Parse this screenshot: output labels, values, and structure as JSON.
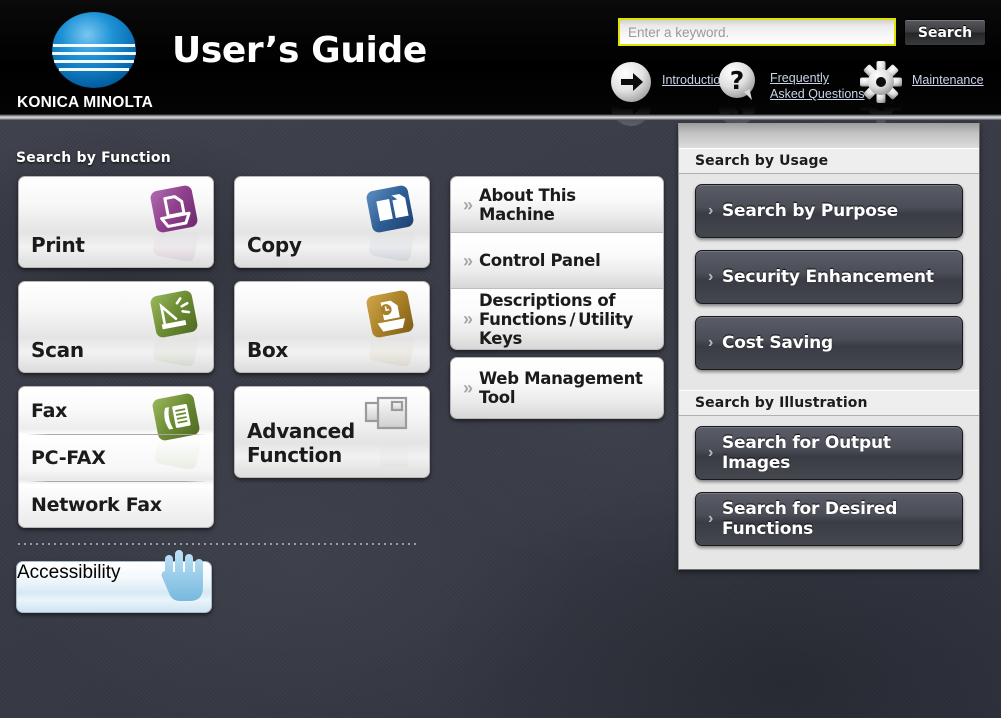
{
  "header": {
    "brand_name": "KONICA MINOLTA",
    "logo_icon": "konica-minolta-globe-logo",
    "title": "User’s Guide",
    "search": {
      "placeholder": "Enter a keyword.",
      "value": "",
      "button_label": "Search",
      "border_color": "#e3e300"
    },
    "nav_links": [
      {
        "label": "Introduction",
        "icon": "arrow-right-circle-icon"
      },
      {
        "label": "Frequently Asked Questions",
        "icon": "question-mark-bubble-icon"
      },
      {
        "label": "Maintenance",
        "icon": "gear-icon"
      }
    ]
  },
  "function_section": {
    "label": "Search by Function",
    "cards": [
      {
        "title": "Print",
        "icon": "printer-icon",
        "color": "#8e3f8c"
      },
      {
        "title": "Copy",
        "icon": "copy-document-icon",
        "color": "#2f5f96"
      },
      {
        "title": "Scan",
        "icon": "scanner-icon",
        "color": "#6c8c34"
      },
      {
        "title": "Box",
        "icon": "box-storage-icon",
        "color": "#a98128"
      },
      {
        "title": "Advanced Function",
        "icon": "advanced-function-icon",
        "color": "#b5b5b5"
      }
    ],
    "fax_group": {
      "icon": "fax-machine-icon",
      "color": "#6c8c34",
      "rows": [
        "Fax",
        "PC-FAX",
        "Network Fax"
      ]
    },
    "accessibility": {
      "title": "Accessibility",
      "icon": "hand-pointer-icon",
      "color": "#9ccfea"
    }
  },
  "center_list": {
    "chevron_icon": "double-chevron-right-icon",
    "group_main": [
      "About This Machine",
      "Control Panel",
      "Descriptions of Functions / Utility Keys"
    ],
    "group_web": [
      "Web Management Tool"
    ]
  },
  "right_panel": {
    "usage": {
      "heading": "Search by Usage",
      "chevron_icon": "chevron-right-icon",
      "buttons": [
        "Search by Purpose",
        "Security Enhancement",
        "Cost Saving"
      ]
    },
    "illustration": {
      "heading": "Search by Illustration",
      "chevron_icon": "chevron-right-icon",
      "buttons": [
        "Search for Output Images",
        "Search for Desired Functions"
      ]
    }
  }
}
